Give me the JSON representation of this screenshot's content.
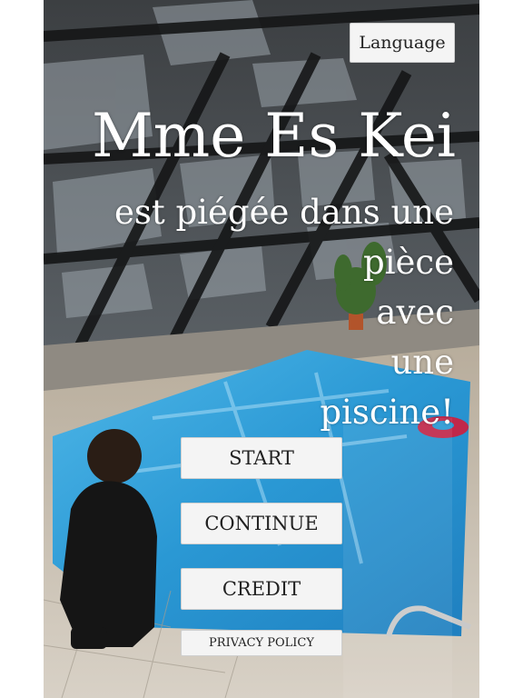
{
  "header": {
    "language_label": "Language"
  },
  "title": {
    "main": "Mme Es Kei",
    "subtitle_lines": [
      "est piégée dans une",
      "pièce",
      "avec",
      "une",
      "piscine!"
    ]
  },
  "menu": {
    "start_label": "START",
    "continue_label": "CONTINUE",
    "credit_label": "CREDIT",
    "privacy_label": "PRIVACY POLICY"
  },
  "colors": {
    "button_bg": "#f4f4f4",
    "title_text": "#ffffff",
    "pool_water": "#2f9fd8"
  }
}
